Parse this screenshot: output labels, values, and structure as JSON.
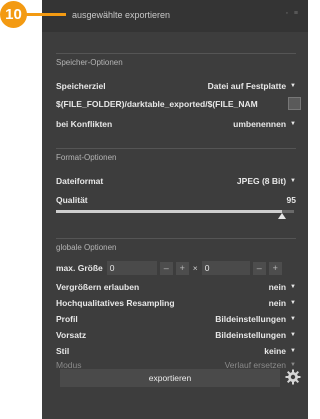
{
  "callout": {
    "number": "10"
  },
  "module": {
    "title": "ausgewählte exportieren",
    "header_icons": "◦ ≡"
  },
  "storage": {
    "section_title": "Speicher-Optionen",
    "target_label": "Speicherziel",
    "target_value": "Datei auf Festplatte",
    "path_value": "$(FILE_FOLDER)/darktable_exported/$(FILE_NAM",
    "conflict_label": "bei Konflikten",
    "conflict_value": "umbenennen"
  },
  "format": {
    "section_title": "Format-Optionen",
    "filetype_label": "Dateiformat",
    "filetype_value": "JPEG (8 Bit)",
    "quality_label": "Qualität",
    "quality_value": "95",
    "quality_fraction": 0.95
  },
  "global": {
    "section_title": "globale Optionen",
    "maxsize_label": "max. Größe",
    "width_value": "0",
    "height_value": "0",
    "minus": "–",
    "plus": "+",
    "times": "×",
    "upscale_label": "Vergrößern erlauben",
    "upscale_value": "nein",
    "hq_label": "Hochqualitatives Resampling",
    "hq_value": "nein",
    "profile_label": "Profil",
    "profile_value": "Bildeinstellungen",
    "intent_label": "Vorsatz",
    "intent_value": "Bildeinstellungen",
    "style_label": "Stil",
    "style_value": "keine",
    "mode_label": "Modus",
    "mode_value": "Verlauf ersetzen"
  },
  "actions": {
    "export_label": "exportieren"
  },
  "colors": {
    "accent": "#f39a12",
    "panel": "#3d3d3d",
    "header": "#343434"
  }
}
